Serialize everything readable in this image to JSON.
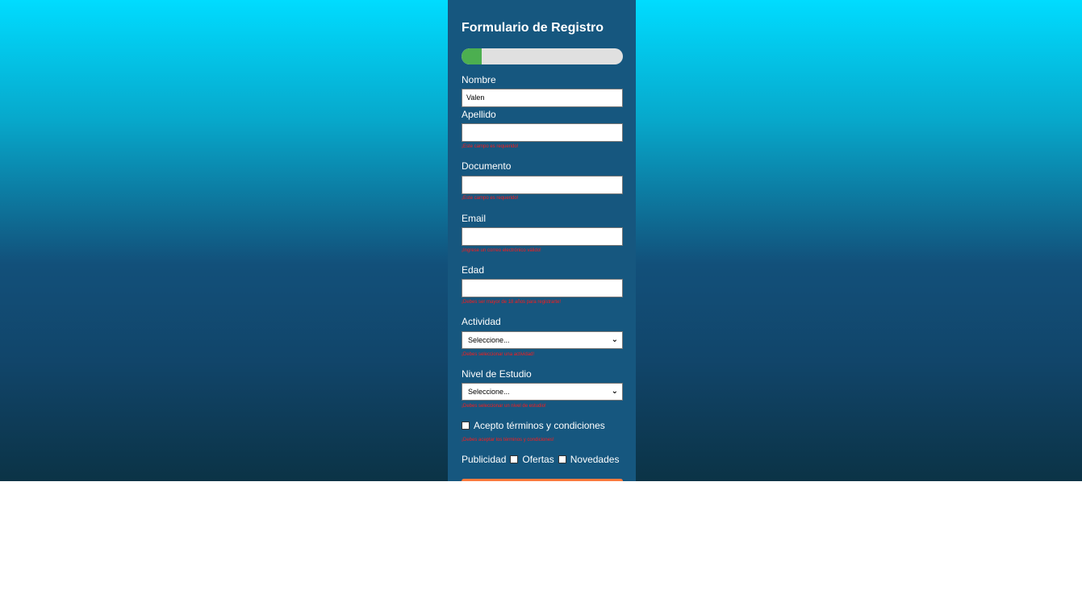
{
  "form": {
    "title": "Formulario de Registro",
    "progress_fraction": 0.125,
    "colors": {
      "progress_fill": "#4caf50",
      "error": "#ff1a1a",
      "submit": "#ff7a3d"
    },
    "fields": {
      "nombre": {
        "label": "Nombre",
        "value": "Valen"
      },
      "apellido": {
        "label": "Apellido",
        "value": "",
        "error": "¡Este campo es requerido!"
      },
      "documento": {
        "label": "Documento",
        "value": "",
        "error": "¡Este campo es requerido!"
      },
      "email": {
        "label": "Email",
        "value": "",
        "error": "¡Ingrese un correo electrónico válido!"
      },
      "edad": {
        "label": "Edad",
        "value": "",
        "error": "¡Debes ser mayor de 18 años para registrarte!"
      },
      "actividad": {
        "label": "Actividad",
        "selected": "Seleccione...",
        "error": "¡Debes seleccionar una actividad!"
      },
      "nivel": {
        "label": "Nivel de Estudio",
        "selected": "Seleccione...",
        "error": "¡Debes seleccionar un nivel de estudio!"
      }
    },
    "terms": {
      "label": "Acepto términos y condiciones",
      "error": "¡Debes aceptar los términos y condiciones!"
    },
    "publicidad": {
      "label": "Publicidad",
      "options": [
        "Ofertas",
        "Novedades"
      ]
    },
    "select_chevron": "⌄"
  }
}
